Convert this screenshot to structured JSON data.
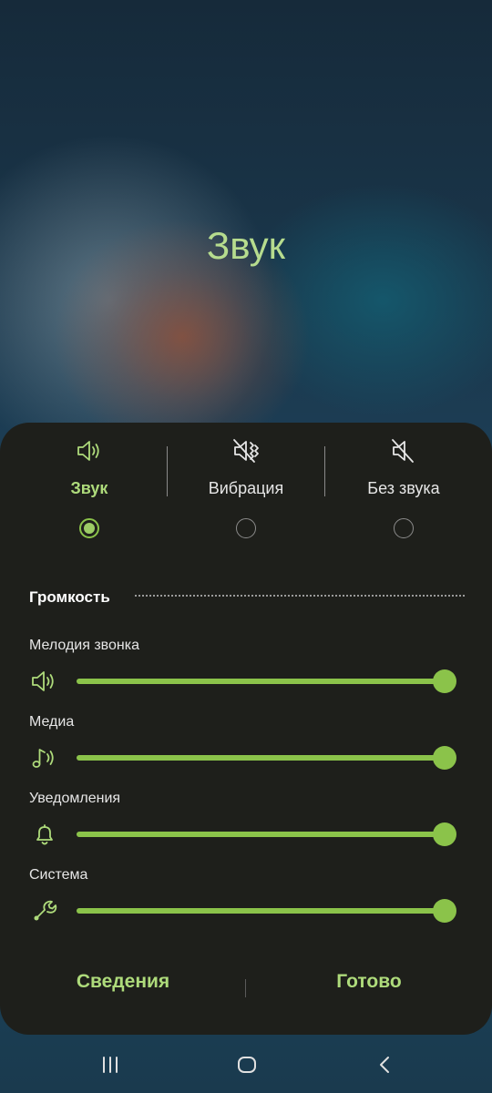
{
  "title": "Звук",
  "modes": [
    {
      "label": "Звук",
      "icon": "speaker-icon",
      "selected": true
    },
    {
      "label": "Вибрация",
      "icon": "vibrate-icon",
      "selected": false
    },
    {
      "label": "Без звука",
      "icon": "mute-icon",
      "selected": false
    }
  ],
  "volume": {
    "header": "Громкость",
    "sliders": [
      {
        "label": "Мелодия звонка",
        "icon": "speaker-icon",
        "level_percent": 100
      },
      {
        "label": "Медиа",
        "icon": "music-note-icon",
        "level_percent": 100
      },
      {
        "label": "Уведомления",
        "icon": "bell-icon",
        "level_percent": 100
      },
      {
        "label": "Система",
        "icon": "wrench-icon",
        "level_percent": 100
      }
    ]
  },
  "buttons": {
    "details": "Сведения",
    "done": "Готово"
  },
  "colors": {
    "accent": "#8bc34a",
    "accent_text": "#aedb7b",
    "panel": "#1e1f1b"
  },
  "navbar": [
    "recent-apps-icon",
    "home-icon",
    "back-icon"
  ]
}
